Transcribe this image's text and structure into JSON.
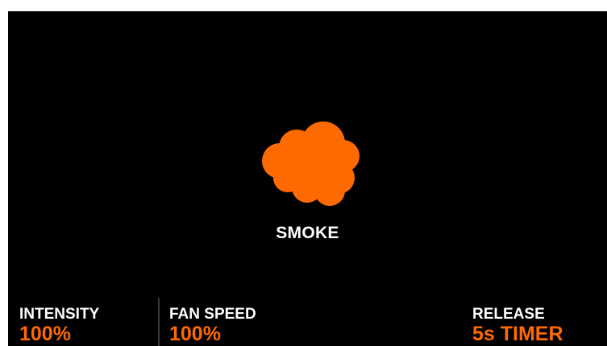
{
  "mode": {
    "icon": "smoke-cloud-icon",
    "label": "SMOKE",
    "accent_color": "#ff6a00"
  },
  "stats": {
    "intensity": {
      "label": "INTENSITY",
      "value": "100%"
    },
    "fan_speed": {
      "label": "FAN SPEED",
      "value": "100%"
    },
    "release": {
      "label": "RELEASE",
      "value": "5s TIMER"
    }
  }
}
